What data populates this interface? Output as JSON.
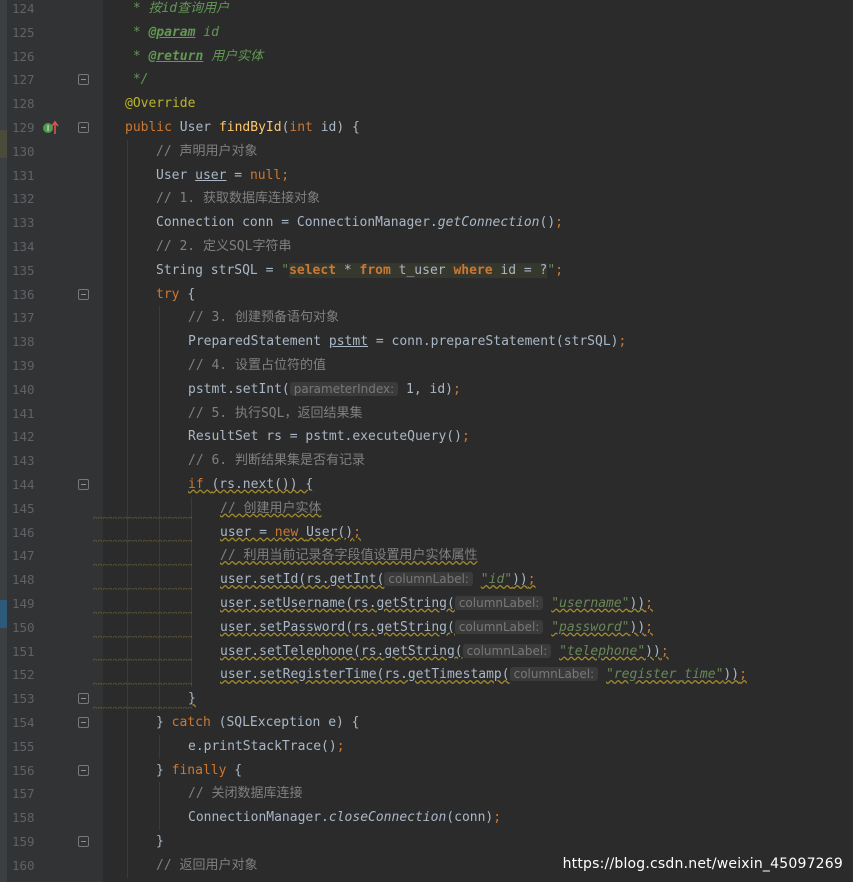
{
  "lines": [
    {
      "n": "124",
      "parts": [
        {
          "t": " * 按",
          "c": "dc"
        },
        {
          "t": "id",
          "c": "dc it"
        },
        {
          "t": "查询用户",
          "c": "dc"
        }
      ],
      "ind": "ind3x"
    },
    {
      "n": "125",
      "parts": [
        {
          "t": " * ",
          "c": "dc"
        },
        {
          "t": "@param",
          "c": "tag"
        },
        {
          "t": " ",
          "c": "dc"
        },
        {
          "t": "id",
          "c": "dc it"
        }
      ]
    },
    {
      "n": "126",
      "parts": [
        {
          "t": " * ",
          "c": "dc"
        },
        {
          "t": "@return",
          "c": "tag"
        },
        {
          "t": " 用户实体",
          "c": "dc"
        }
      ]
    },
    {
      "n": "127",
      "parts": [
        {
          "t": " */",
          "c": "dc"
        }
      ],
      "fold": "end"
    },
    {
      "n": "128",
      "parts": [
        {
          "t": "@Override",
          "c": "ann"
        }
      ]
    },
    {
      "n": "129",
      "parts": [
        {
          "t": "public ",
          "c": "kw"
        },
        {
          "t": "User "
        },
        {
          "t": "findById",
          "c": "fn"
        },
        {
          "t": "("
        },
        {
          "t": "int ",
          "c": "kw"
        },
        {
          "t": "id) {"
        }
      ],
      "fold": "start",
      "icons": true
    },
    {
      "n": "130",
      "ind": 1,
      "parts": [
        {
          "t": "// 声明用户对象",
          "c": "cm"
        }
      ]
    },
    {
      "n": "131",
      "ind": 1,
      "parts": [
        {
          "t": "User "
        },
        {
          "t": "user",
          "c": "ul"
        },
        {
          "t": " = "
        },
        {
          "t": "null",
          "c": "kw"
        },
        {
          "t": ";",
          "c": "kw"
        }
      ]
    },
    {
      "n": "132",
      "ind": 1,
      "parts": [
        {
          "t": "// 1. 获取数据库连接对象",
          "c": "cm"
        }
      ]
    },
    {
      "n": "133",
      "ind": 1,
      "parts": [
        {
          "t": "Connection conn = ConnectionManager."
        },
        {
          "t": "getConnection",
          "c": "it"
        },
        {
          "t": "()"
        },
        {
          "t": ";",
          "c": "kw"
        }
      ]
    },
    {
      "n": "134",
      "ind": 1,
      "parts": [
        {
          "t": "// 2. 定义SQL字符串",
          "c": "cm"
        }
      ]
    },
    {
      "n": "135",
      "ind": 1,
      "parts": [
        {
          "t": "String strSQL = "
        },
        {
          "t": "\"",
          "c": "str"
        },
        {
          "t": "select",
          "c": "sqlkw sqlbg"
        },
        {
          "t": " * ",
          "c": "sq sqlbg"
        },
        {
          "t": "from",
          "c": "sqlkw sqlbg"
        },
        {
          "t": " t_user ",
          "c": "sq sqlbg"
        },
        {
          "t": "where",
          "c": "sqlkw sqlbg"
        },
        {
          "t": " id = ?",
          "c": "sq sqlbg"
        },
        {
          "t": "\"",
          "c": "str"
        },
        {
          "t": ";",
          "c": "kw"
        }
      ]
    },
    {
      "n": "136",
      "ind": 1,
      "parts": [
        {
          "t": "try ",
          "c": "kw"
        },
        {
          "t": "{"
        }
      ],
      "fold": "start"
    },
    {
      "n": "137",
      "ind": 2,
      "parts": [
        {
          "t": "// 3. 创建预备语句对象",
          "c": "cm"
        }
      ]
    },
    {
      "n": "138",
      "ind": 2,
      "parts": [
        {
          "t": "PreparedStatement "
        },
        {
          "t": "pstmt",
          "c": "ul"
        },
        {
          "t": " = conn.prepareStatement(strSQL)"
        },
        {
          "t": ";",
          "c": "kw"
        }
      ]
    },
    {
      "n": "139",
      "ind": 2,
      "parts": [
        {
          "t": "// 4. 设置占位符的值",
          "c": "cm"
        }
      ]
    },
    {
      "n": "140",
      "ind": 2,
      "parts": [
        {
          "t": "pstmt.setInt("
        },
        {
          "t": "parameterIndex:",
          "c": "hint"
        },
        {
          "t": " 1, id)"
        },
        {
          "t": ";",
          "c": "kw"
        }
      ]
    },
    {
      "n": "141",
      "ind": 2,
      "parts": [
        {
          "t": "// 5. 执行SQL，返回结果集",
          "c": "cm"
        }
      ]
    },
    {
      "n": "142",
      "ind": 2,
      "parts": [
        {
          "t": "ResultSet rs = pstmt.executeQuery()"
        },
        {
          "t": ";",
          "c": "kw"
        }
      ]
    },
    {
      "n": "143",
      "ind": 2,
      "parts": [
        {
          "t": "// 6. 判断结果集是否有记录",
          "c": "cm"
        }
      ]
    },
    {
      "n": "144",
      "ind": 2,
      "parts": [
        {
          "t": "if ",
          "c": "kw warn"
        },
        {
          "t": "(rs.next()) {",
          "c": "warn"
        }
      ],
      "fold": "start"
    },
    {
      "n": "145",
      "ind": 3,
      "parts": [
        {
          "t": "// 创建用户实体",
          "c": "cm warn"
        }
      ],
      "wavy": true
    },
    {
      "n": "146",
      "ind": 3,
      "parts": [
        {
          "t": "user = ",
          "c": "warn"
        },
        {
          "t": "new ",
          "c": "kw warn"
        },
        {
          "t": "User()",
          "c": "warn"
        },
        {
          "t": ";",
          "c": "kw warn"
        }
      ],
      "wavy": true
    },
    {
      "n": "147",
      "ind": 3,
      "parts": [
        {
          "t": "// 利用当前记录各字段值设置用户实体属性",
          "c": "cm warn"
        }
      ],
      "wavy": true
    },
    {
      "n": "148",
      "ind": 3,
      "parts": [
        {
          "t": "user.setId(rs.getInt(",
          "c": "warn"
        },
        {
          "t": "columnLabel:",
          "c": "hint"
        },
        {
          "t": " "
        },
        {
          "t": "\"id\"",
          "c": "str it warn"
        },
        {
          "t": "))",
          "c": "warn"
        },
        {
          "t": ";",
          "c": "kw warn"
        }
      ],
      "wavy": true
    },
    {
      "n": "149",
      "ind": 3,
      "parts": [
        {
          "t": "user.setUsername(rs.getString(",
          "c": "warn"
        },
        {
          "t": "columnLabel:",
          "c": "hint"
        },
        {
          "t": " "
        },
        {
          "t": "\"username\"",
          "c": "str it warn"
        },
        {
          "t": "))",
          "c": "warn"
        },
        {
          "t": ";",
          "c": "kw warn"
        }
      ],
      "wavy": true
    },
    {
      "n": "150",
      "ind": 3,
      "parts": [
        {
          "t": "user.setPassword(rs.getString(",
          "c": "warn"
        },
        {
          "t": "columnLabel:",
          "c": "hint"
        },
        {
          "t": " "
        },
        {
          "t": "\"password\"",
          "c": "str it warn"
        },
        {
          "t": "))",
          "c": "warn"
        },
        {
          "t": ";",
          "c": "kw warn"
        }
      ],
      "wavy": true
    },
    {
      "n": "151",
      "ind": 3,
      "parts": [
        {
          "t": "user.setTelephone(rs.getString(",
          "c": "warn"
        },
        {
          "t": "columnLabel:",
          "c": "hint"
        },
        {
          "t": " "
        },
        {
          "t": "\"telephone\"",
          "c": "str it warn"
        },
        {
          "t": "))",
          "c": "warn"
        },
        {
          "t": ";",
          "c": "kw warn"
        }
      ],
      "wavy": true
    },
    {
      "n": "152",
      "ind": 3,
      "parts": [
        {
          "t": "user.setRegisterTime(rs.getTimestamp(",
          "c": "warn"
        },
        {
          "t": "columnLabel:",
          "c": "hint"
        },
        {
          "t": " "
        },
        {
          "t": "\"register_time\"",
          "c": "str it warn"
        },
        {
          "t": "))",
          "c": "warn"
        },
        {
          "t": ";",
          "c": "kw warn"
        }
      ],
      "wavy": true
    },
    {
      "n": "153",
      "ind": 2,
      "parts": [
        {
          "t": "}",
          "c": "warn"
        }
      ],
      "fold": "end",
      "wavy": true
    },
    {
      "n": "154",
      "ind": 1,
      "parts": [
        {
          "t": "} "
        },
        {
          "t": "catch ",
          "c": "kw"
        },
        {
          "t": "(SQLException e) {"
        }
      ],
      "fold": "mid"
    },
    {
      "n": "155",
      "ind": 2,
      "parts": [
        {
          "t": "e.printStackTrace()"
        },
        {
          "t": ";",
          "c": "kw"
        }
      ]
    },
    {
      "n": "156",
      "ind": 1,
      "parts": [
        {
          "t": "} "
        },
        {
          "t": "finally ",
          "c": "kw"
        },
        {
          "t": "{"
        }
      ],
      "fold": "mid"
    },
    {
      "n": "157",
      "ind": 2,
      "parts": [
        {
          "t": "// 关闭数据库连接",
          "c": "cm"
        }
      ]
    },
    {
      "n": "158",
      "ind": 2,
      "parts": [
        {
          "t": "ConnectionManager."
        },
        {
          "t": "closeConnection",
          "c": "it"
        },
        {
          "t": "(conn)"
        },
        {
          "t": ";",
          "c": "kw"
        }
      ]
    },
    {
      "n": "159",
      "ind": 1,
      "parts": [
        {
          "t": "}"
        }
      ],
      "fold": "end"
    },
    {
      "n": "160",
      "ind": 1,
      "parts": [
        {
          "t": "// 返回用户对象",
          "c": "cm"
        }
      ]
    }
  ],
  "watermark": "https://blog.csdn.net/weixin_45097269",
  "colors": {
    "background": "#2b2b2b",
    "gutter": "#313335",
    "keyword": "#cc7832",
    "comment": "#808080",
    "javadoc": "#629755",
    "string": "#6a8759",
    "method": "#ffc66d",
    "annotation": "#bbb529"
  }
}
